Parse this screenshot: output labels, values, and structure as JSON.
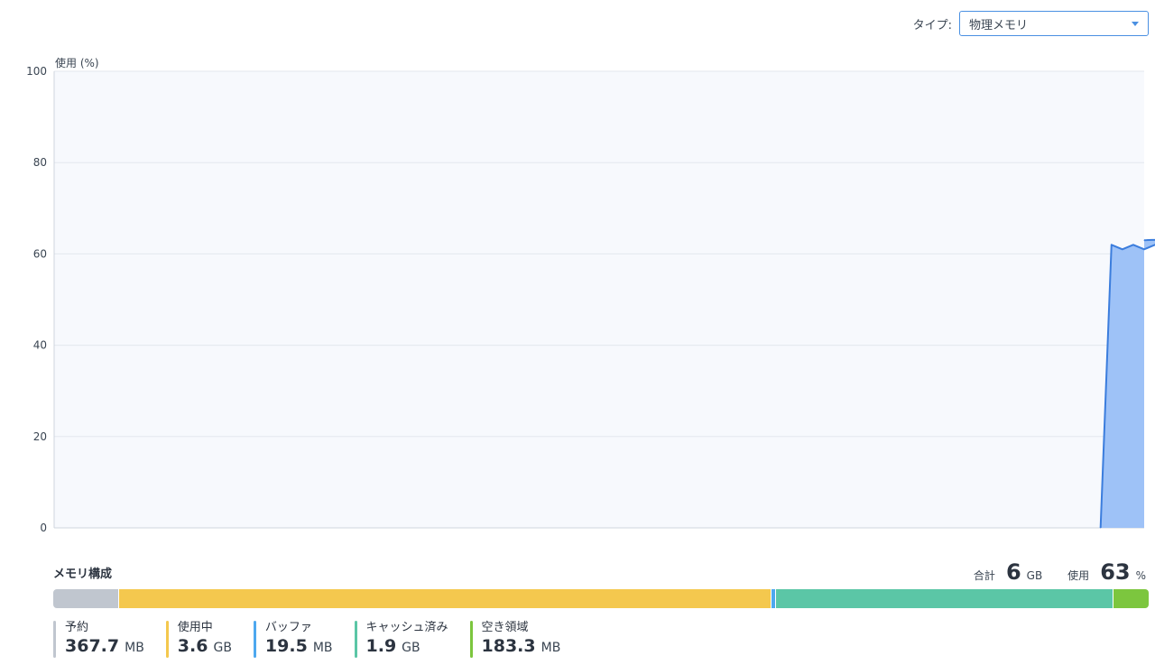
{
  "header": {
    "type_label": "タイプ:",
    "type_value": "物理メモリ"
  },
  "chart_data": {
    "type": "area",
    "ylabel": "使用 (%)",
    "ylim": [
      0,
      100
    ],
    "yticks": [
      0,
      20,
      40,
      60,
      80,
      100
    ],
    "grid": true,
    "x_count": 100,
    "x_start_index": 96,
    "series": [
      {
        "values": [
          0,
          62,
          61,
          62,
          61,
          62,
          63,
          62,
          62,
          63,
          62,
          63,
          64,
          62,
          63,
          64,
          63
        ],
        "color": "#3b7ddd",
        "fill": "#9ec2f7"
      }
    ]
  },
  "composition": {
    "title": "メモリ構成",
    "total_label": "合計",
    "total_value": "6",
    "total_unit": "GB",
    "usage_label": "使用",
    "usage_value": "63",
    "usage_unit": "%",
    "segments": [
      {
        "label": "予約",
        "value": "367.7",
        "unit": "MB",
        "fraction": 0.059,
        "color": "#c0c6cf"
      },
      {
        "label": "使用中",
        "value": "3.6",
        "unit": "GB",
        "fraction": 0.596,
        "color": "#f4c84e"
      },
      {
        "label": "バッファ",
        "value": "19.5",
        "unit": "MB",
        "fraction": 0.004,
        "color": "#4ea8ef"
      },
      {
        "label": "キャッシュ済み",
        "value": "1.9",
        "unit": "GB",
        "fraction": 0.308,
        "color": "#5bc6a6"
      },
      {
        "label": "空き領域",
        "value": "183.3",
        "unit": "MB",
        "fraction": 0.033,
        "color": "#7cc63e"
      }
    ]
  }
}
